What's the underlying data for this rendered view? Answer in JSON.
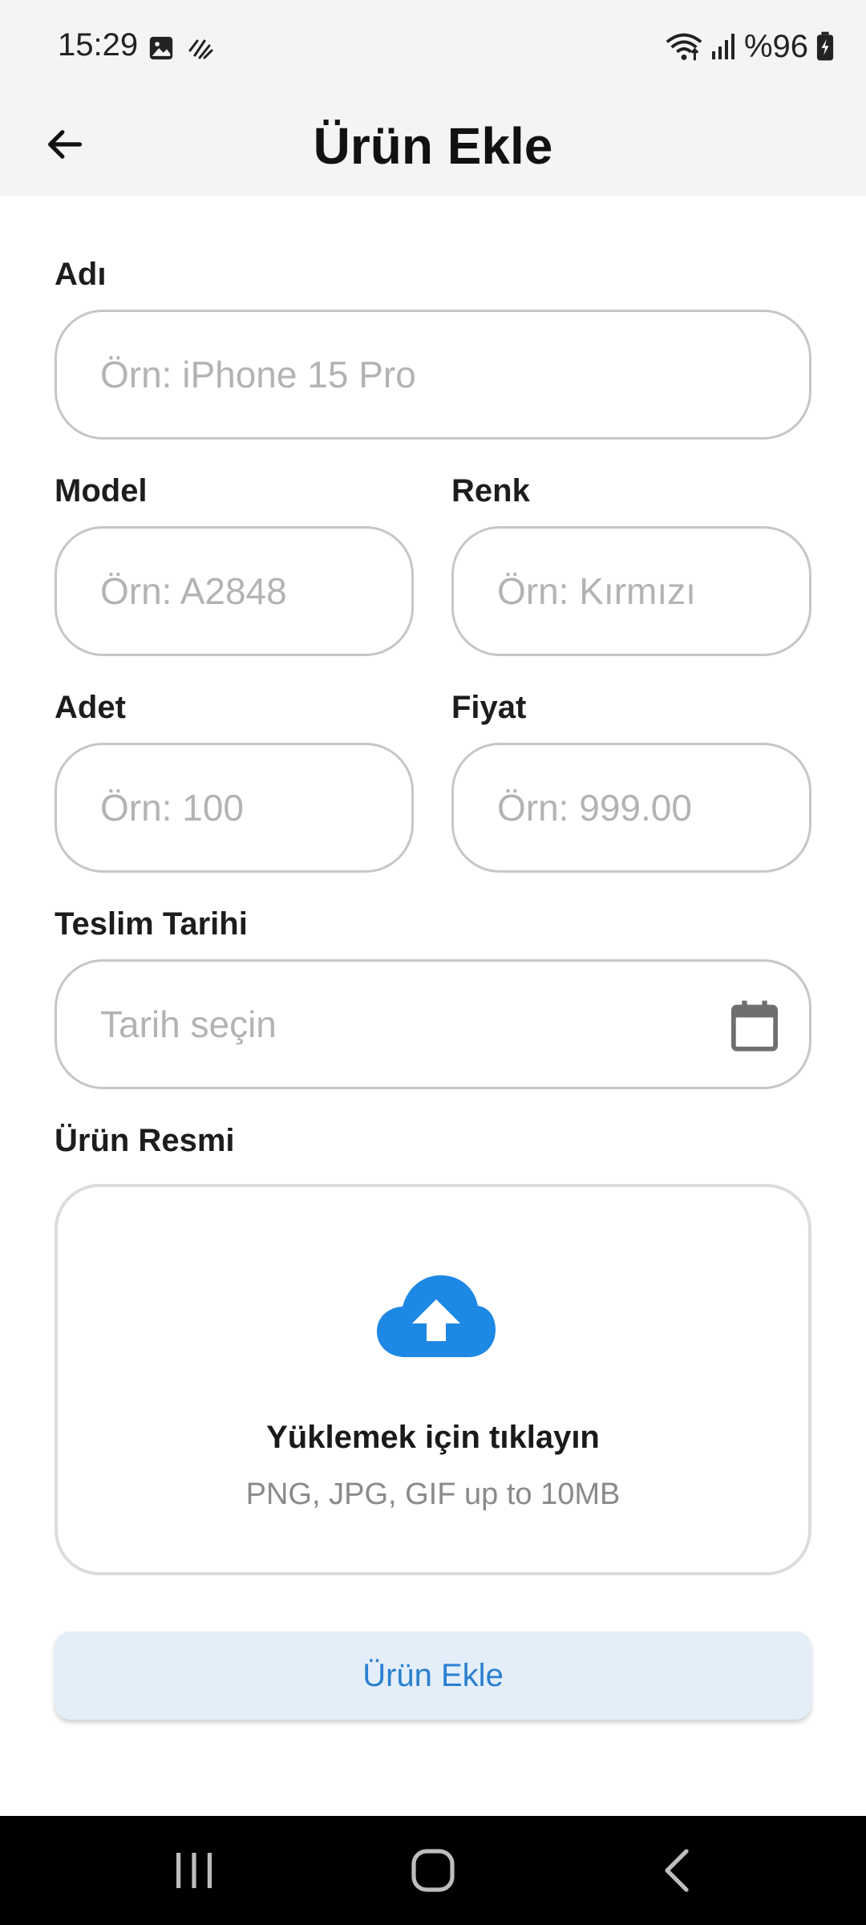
{
  "status_bar": {
    "time": "15:29",
    "battery": "%96"
  },
  "header": {
    "title": "Ürün Ekle"
  },
  "form": {
    "name": {
      "label": "Adı",
      "placeholder": "Örn: iPhone 15 Pro"
    },
    "model": {
      "label": "Model",
      "placeholder": "Örn: A2848"
    },
    "color": {
      "label": "Renk",
      "placeholder": "Örn: Kırmızı"
    },
    "quantity": {
      "label": "Adet",
      "placeholder": "Örn: 100"
    },
    "price": {
      "label": "Fiyat",
      "placeholder": "Örn: 999.00"
    },
    "delivery_date": {
      "label": "Teslim Tarihi",
      "placeholder": "Tarih seçin"
    },
    "image": {
      "label": "Ürün Resmi",
      "upload_title": "Yüklemek için tıklayın",
      "upload_hint": "PNG, JPG, GIF up to 10MB"
    },
    "submit_label": "Ürün Ekle"
  },
  "colors": {
    "accent": "#2a7fd0",
    "upload_icon": "#1e88e5",
    "submit_bg": "#e3eef9"
  },
  "icons": {
    "back": "arrow-left-icon",
    "calendar": "calendar-icon",
    "upload": "cloud-upload-icon"
  }
}
